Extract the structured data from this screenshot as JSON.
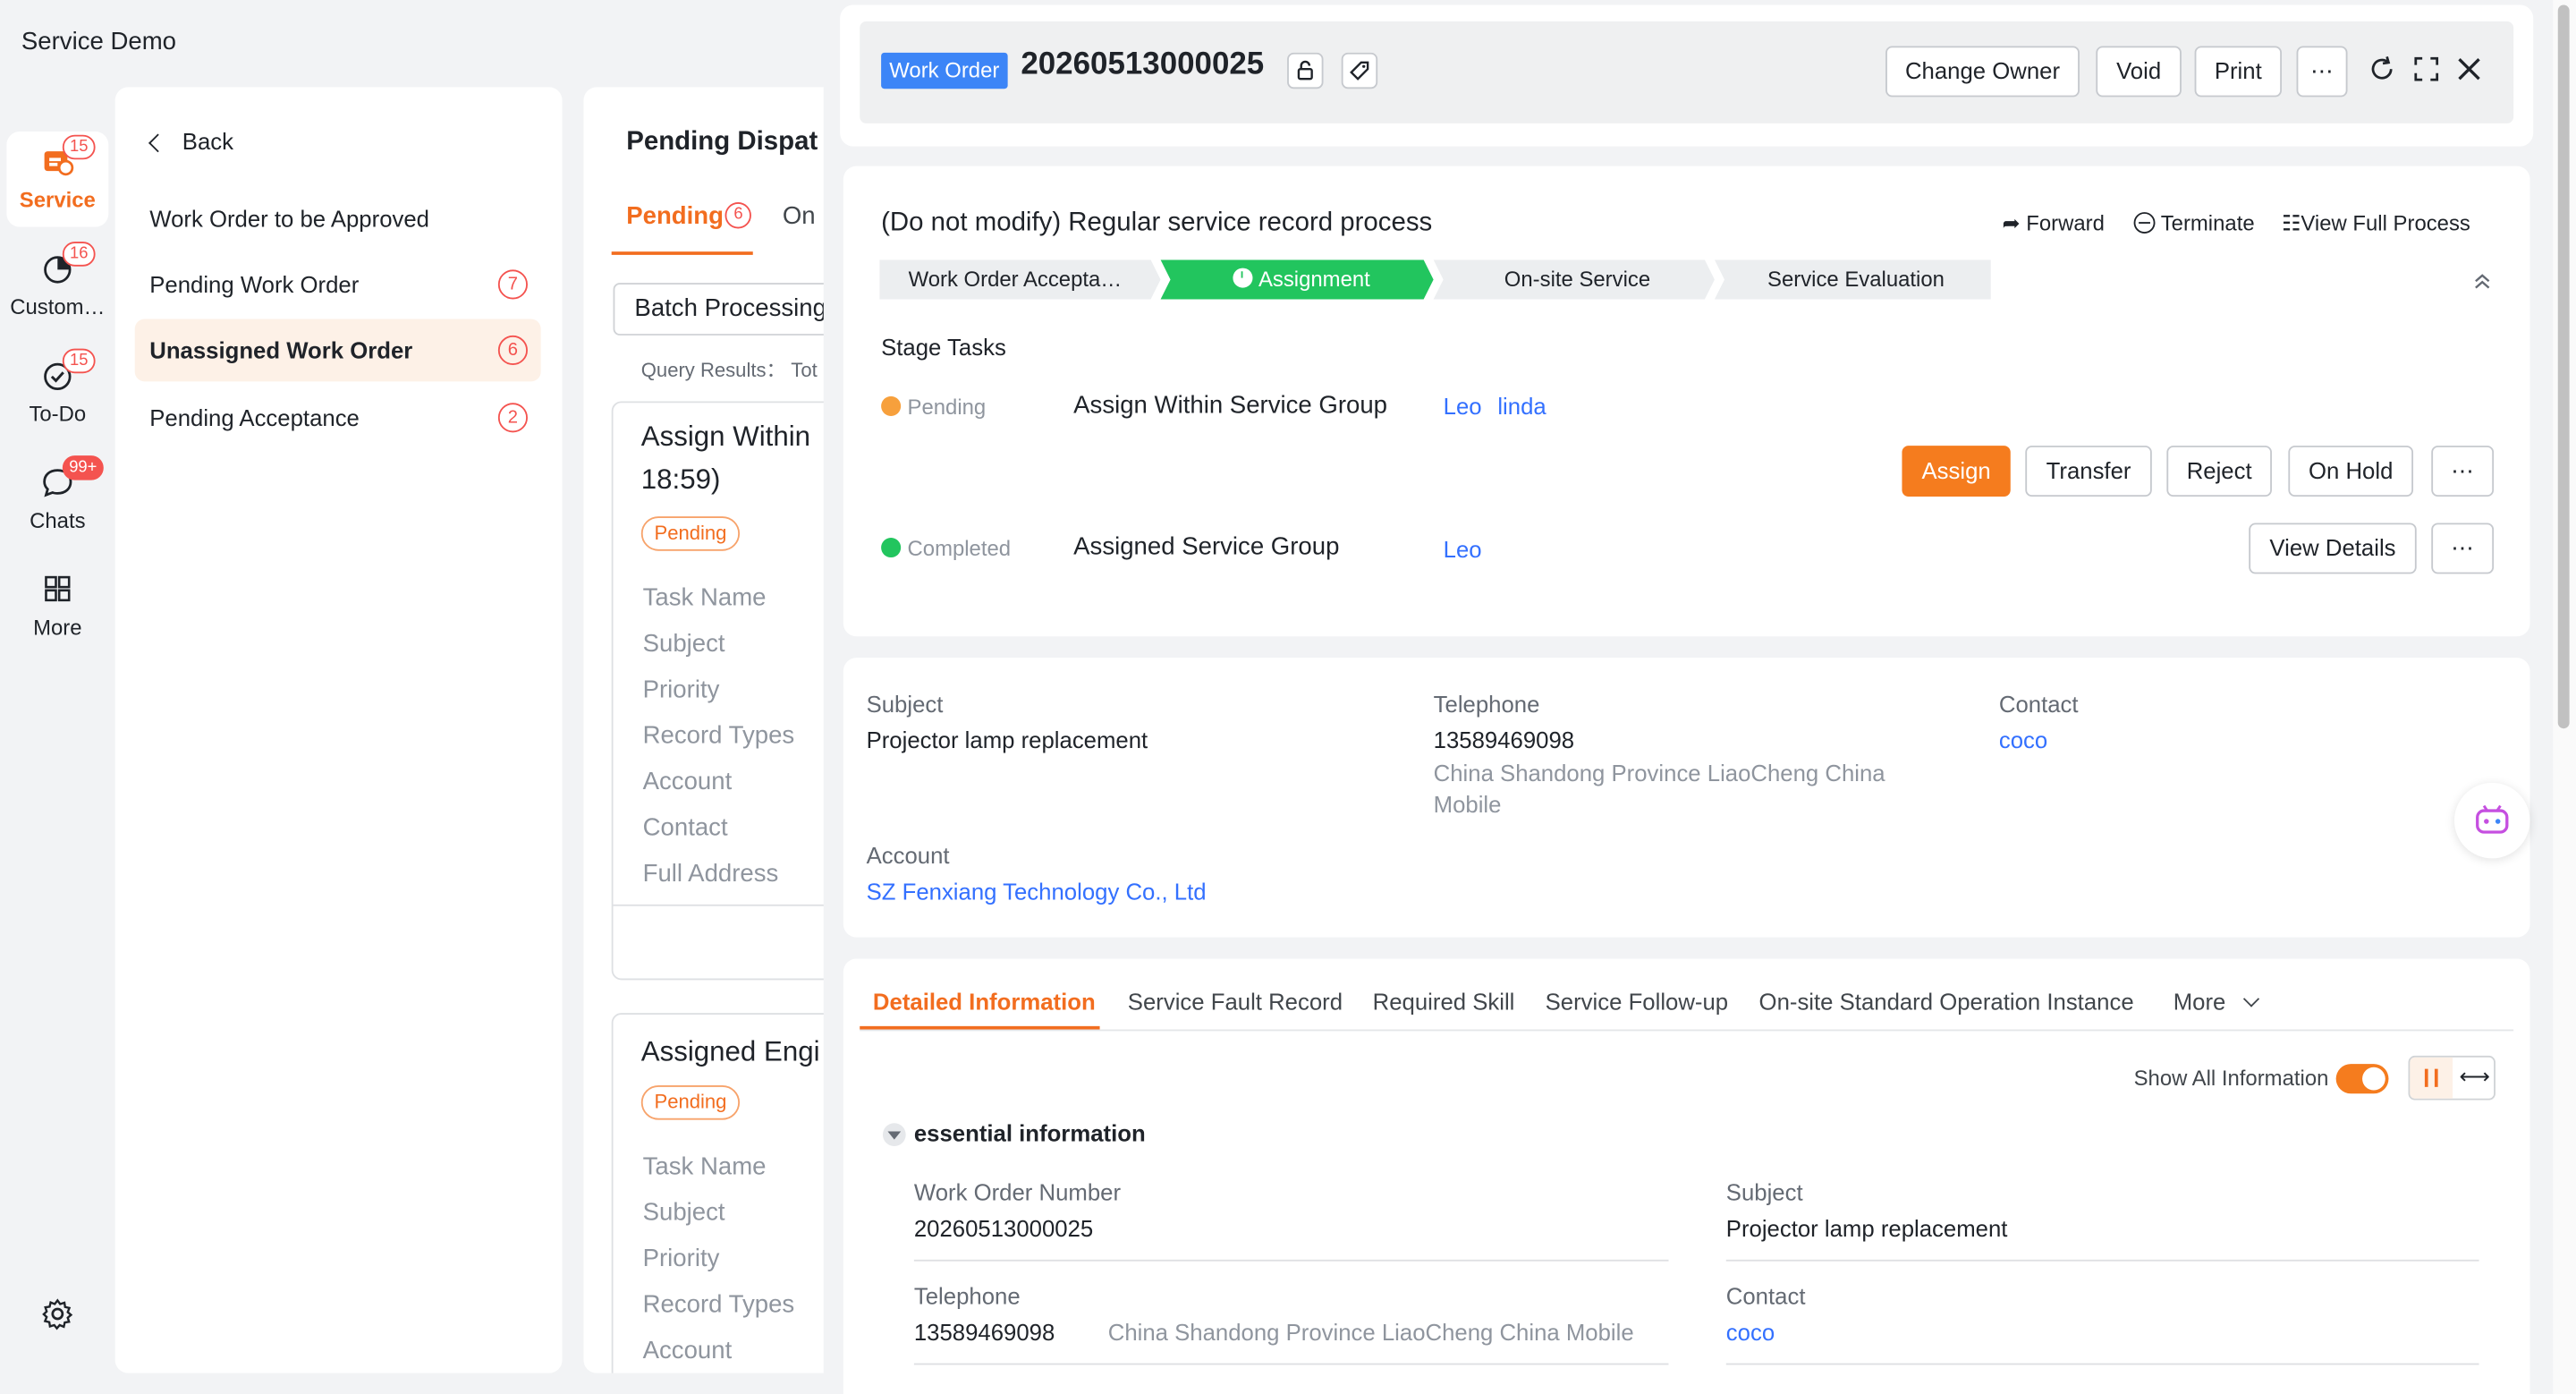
{
  "app": {
    "title": "Service Demo"
  },
  "rail": {
    "items": [
      {
        "label": "Service",
        "badge": "15",
        "icon": "service-icon"
      },
      {
        "label": "Custom…",
        "badge": "16",
        "icon": "customer-icon"
      },
      {
        "label": "To-Do",
        "badge": "15",
        "icon": "todo-icon"
      },
      {
        "label": "Chats",
        "badge": "99+",
        "icon": "chat-icon"
      },
      {
        "label": "More",
        "icon": "grid-icon"
      }
    ],
    "settings_icon": "gear-icon"
  },
  "menu": {
    "back": "Back",
    "items": [
      {
        "label": "Work Order to be Approved"
      },
      {
        "label": "Pending Work Order",
        "count": "7"
      },
      {
        "label": "Unassigned Work Order",
        "count": "6"
      },
      {
        "label": "Pending Acceptance",
        "count": "2"
      }
    ]
  },
  "list": {
    "title": "Pending Dispat",
    "tabs": [
      {
        "label": "Pending",
        "count": "6"
      },
      {
        "label": "On"
      }
    ],
    "batch": "Batch Processing",
    "query": "Query Results： Tot",
    "cards": [
      {
        "title_line1": "Assign Within",
        "title_line2": "18:59)",
        "status": "Pending",
        "fields": [
          "Task Name",
          "Subject",
          "Priority",
          "Record Types",
          "Account",
          "Contact",
          "Full Address"
        ]
      },
      {
        "title_line1": "Assigned Engi",
        "status": "Pending",
        "fields": [
          "Task Name",
          "Subject",
          "Priority",
          "Record Types",
          "Account"
        ]
      }
    ]
  },
  "header": {
    "tag": "Work Order",
    "number": "20260513000025",
    "buttons": {
      "change_owner": "Change Owner",
      "void": "Void",
      "print": "Print",
      "more": "⋯"
    }
  },
  "process": {
    "title": "(Do not modify) Regular service record process",
    "actions": {
      "forward": "Forward",
      "terminate": "Terminate",
      "view_full": "View Full Process"
    },
    "steps": [
      "Work Order Accepta…",
      "Assignment",
      "On-site Service",
      "Service Evaluation"
    ],
    "stage_tasks": "Stage Tasks",
    "tasks": [
      {
        "status": "Pending",
        "name": "Assign Within Service Group",
        "people": [
          "Leo",
          "linda"
        ],
        "buttons": [
          "Assign",
          "Transfer",
          "Reject",
          "On Hold"
        ]
      },
      {
        "status": "Completed",
        "name": "Assigned Service Group",
        "people": [
          "Leo"
        ],
        "buttons": [
          "View Details"
        ]
      }
    ],
    "more": "⋯"
  },
  "summary": {
    "subject_label": "Subject",
    "subject_value": "Projector lamp replacement",
    "telephone_label": "Telephone",
    "telephone_value": "13589469098",
    "address_line1": "China Shandong Province LiaoCheng China",
    "address_line2": "Mobile",
    "contact_label": "Contact",
    "contact_value": "coco",
    "account_label": "Account",
    "account_value": "SZ Fenxiang Technology Co., Ltd"
  },
  "details": {
    "tabs": [
      "Detailed Information",
      "Service Fault Record",
      "Required Skill",
      "Service Follow-up",
      "On-site Standard Operation Instance",
      "More"
    ],
    "show_all": "Show All Information",
    "section": "essential information",
    "fields": {
      "wo_number_label": "Work Order Number",
      "wo_number_value": "20260513000025",
      "subject_label": "Subject",
      "subject_value": "Projector lamp replacement",
      "telephone_label": "Telephone",
      "telephone_value": "13589469098",
      "telephone_address": "China Shandong Province LiaoCheng China Mobile",
      "contact_label": "Contact",
      "contact_value": "coco"
    }
  },
  "colors": {
    "accent": "#f26d1f",
    "link": "#3370ff",
    "tag_blue": "#3c85f7",
    "step_active": "#22c55e"
  }
}
